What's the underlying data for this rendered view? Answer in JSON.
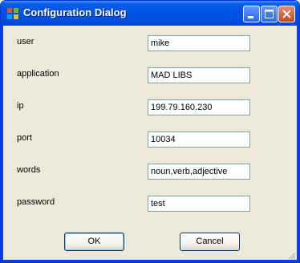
{
  "window": {
    "title": "Configuration Dialog",
    "app_icon": "windows-form-icon",
    "controls": [
      "minimize-icon",
      "maximize-icon",
      "close-icon"
    ]
  },
  "form": {
    "fields": [
      {
        "label": "user",
        "value": "mike"
      },
      {
        "label": "application",
        "value": "MAD LIBS"
      },
      {
        "label": "ip",
        "value": "199.79.160.230"
      },
      {
        "label": "port",
        "value": "10034"
      },
      {
        "label": "words",
        "value": "noun,verb,adjective"
      },
      {
        "label": "password",
        "value": "test"
      }
    ]
  },
  "buttons": {
    "ok_label": "OK",
    "cancel_label": "Cancel"
  },
  "colors": {
    "titlebar": "#0054e3",
    "frame": "#0842d6",
    "dialog_bg": "#ece9d8",
    "close_button": "#c84518"
  }
}
